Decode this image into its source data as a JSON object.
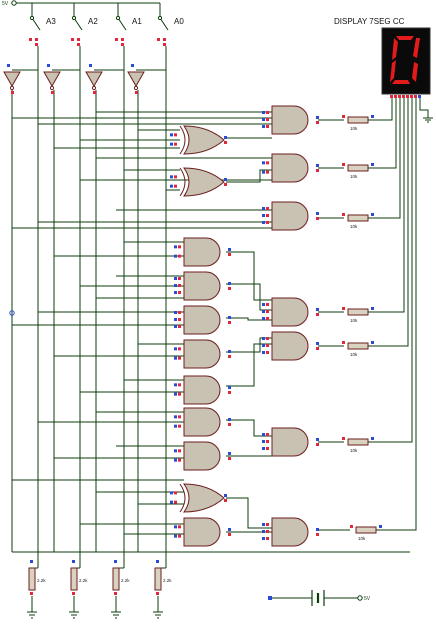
{
  "supply": {
    "top_label": "5V",
    "battery_label": "5V"
  },
  "switches": [
    {
      "label": "A3"
    },
    {
      "label": "A2"
    },
    {
      "label": "A1"
    },
    {
      "label": "A0"
    }
  ],
  "display": {
    "title": "DISPLAY 7SEG CC",
    "digit": "0"
  },
  "pulldowns": [
    {
      "value": "2.2k"
    },
    {
      "value": "2.2k"
    },
    {
      "value": "2.2k"
    },
    {
      "value": "2.2k"
    }
  ],
  "output_resistors": [
    {
      "value": "10k"
    },
    {
      "value": "10k"
    },
    {
      "value": "10k"
    },
    {
      "value": "10k"
    },
    {
      "value": "10k"
    },
    {
      "value": "10k"
    },
    {
      "value": "10k"
    }
  ],
  "colors": {
    "wire": "#0b3d0b",
    "gate_fill": "#c9c2b2",
    "gate_stroke": "#6b1e1e",
    "pin_red": "#e0283c",
    "pin_blue": "#2b4bd6",
    "display_red": "#e31b1b",
    "display_bg": "#0a0a0a"
  }
}
